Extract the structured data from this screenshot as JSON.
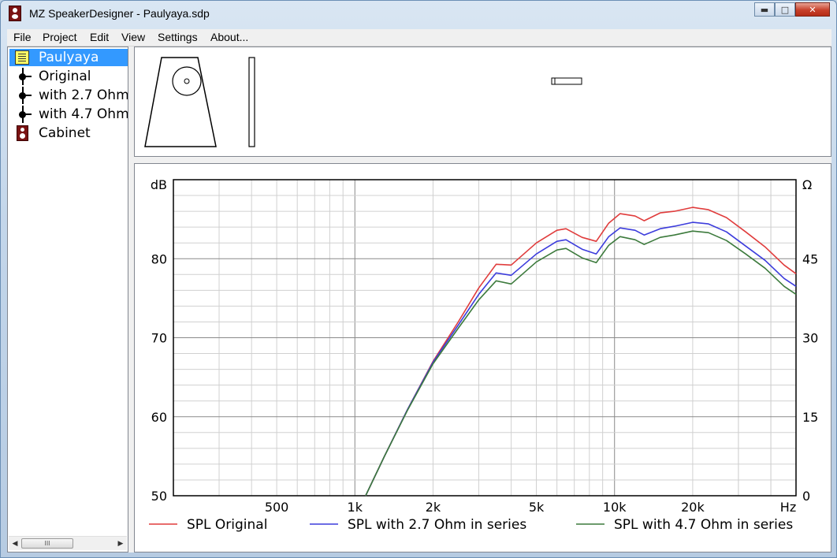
{
  "window": {
    "title": "MZ SpeakerDesigner - Paulyaya.sdp",
    "buttons": {
      "minimize": "▬",
      "maximize": "□",
      "close": "✕"
    }
  },
  "menu": [
    "File",
    "Project",
    "Edit",
    "View",
    "Settings",
    "About..."
  ],
  "tree": {
    "items": [
      {
        "label": "Paulyaya",
        "icon": "project-icon",
        "selected": true
      },
      {
        "label": "Original",
        "icon": "network-icon"
      },
      {
        "label": "with 2.7 Ohm",
        "icon": "network-icon"
      },
      {
        "label": "with 4.7 Ohm",
        "icon": "network-icon"
      },
      {
        "label": "Cabinet",
        "icon": "cabinet-icon"
      }
    ],
    "scroll": {
      "left": "◀",
      "right": "▶",
      "grip": "III"
    }
  },
  "chart_data": {
    "type": "line",
    "ylabel": "dB",
    "y2label": "Ω",
    "xunit": "Hz",
    "xscale": "log",
    "xlim": [
      200,
      50000
    ],
    "ylim": [
      50,
      90
    ],
    "y2lim": [
      0,
      60
    ],
    "x_ticks": [
      {
        "value": 500,
        "label": "500"
      },
      {
        "value": 1000,
        "label": "1k"
      },
      {
        "value": 2000,
        "label": "2k"
      },
      {
        "value": 5000,
        "label": "5k"
      },
      {
        "value": 10000,
        "label": "10k"
      },
      {
        "value": 20000,
        "label": "20k"
      }
    ],
    "y_ticks": [
      50,
      60,
      70,
      80
    ],
    "y2_ticks": [
      0,
      15,
      30,
      45
    ],
    "grid": true,
    "legend": "bottom",
    "x": [
      1100,
      1300,
      1600,
      2000,
      2500,
      3000,
      3500,
      4000,
      5000,
      6000,
      6500,
      7500,
      8500,
      9500,
      10500,
      12000,
      13000,
      15000,
      17000,
      20000,
      23000,
      27000,
      32000,
      38000,
      45000,
      50000
    ],
    "series": [
      {
        "name": "SPL Original",
        "color": "#e03c3c",
        "values": [
          50,
          55,
          61,
          67,
          72,
          76.3,
          79.3,
          79.2,
          82,
          83.6,
          83.8,
          82.7,
          82.2,
          84.5,
          85.7,
          85.4,
          84.8,
          85.8,
          86,
          86.5,
          86.2,
          85.2,
          83.4,
          81.5,
          79.2,
          78.1
        ]
      },
      {
        "name": "SPL with 2.7 Ohm in series",
        "color": "#3c3cdc",
        "values": [
          50,
          55,
          61,
          66.9,
          71.6,
          75.5,
          78.2,
          77.9,
          80.6,
          82.2,
          82.4,
          81.2,
          80.6,
          82.8,
          83.9,
          83.6,
          83,
          83.8,
          84.1,
          84.6,
          84.4,
          83.4,
          81.6,
          79.8,
          77.5,
          76.5
        ]
      },
      {
        "name": "SPL with 4.7 Ohm in series",
        "color": "#3c7a3c",
        "values": [
          50,
          55,
          60.9,
          66.7,
          71.2,
          74.8,
          77.2,
          76.8,
          79.6,
          81.1,
          81.3,
          80.1,
          79.5,
          81.7,
          82.8,
          82.4,
          81.8,
          82.7,
          83,
          83.5,
          83.3,
          82.3,
          80.6,
          78.8,
          76.5,
          75.5
        ]
      }
    ]
  }
}
